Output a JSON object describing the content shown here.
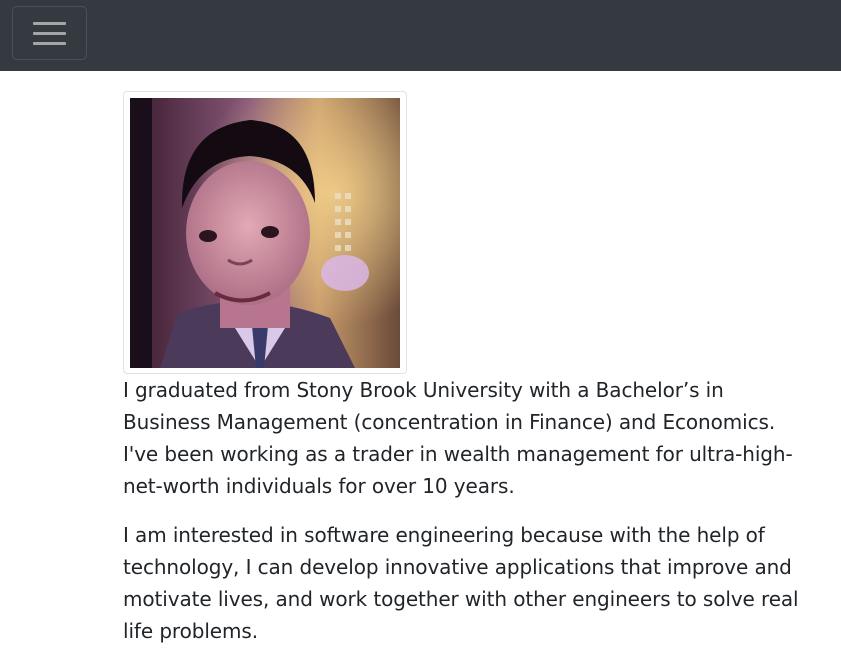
{
  "navbar": {
    "toggler_icon": "hamburger-icon",
    "background": "#343a40"
  },
  "profile": {
    "photo_icon": "profile-photo",
    "paragraphs": [
      "I graduated from Stony Brook University with a Bachelor’s in Business Management (concentration in Finance) and Economics. I've been working as a trader in wealth management for ultra-high-net-worth individuals for over 10 years.",
      "I am interested in software engineering because with the help of technology, I can develop innovative applications that improve and motivate lives, and work together with other engineers to solve real life problems."
    ]
  }
}
